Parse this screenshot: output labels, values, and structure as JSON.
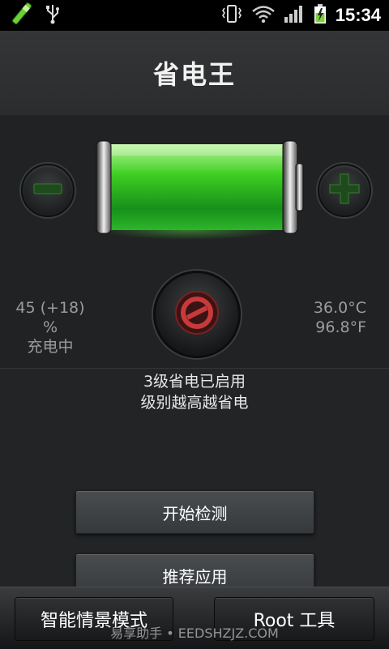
{
  "status_bar": {
    "time": "15:34",
    "icons": [
      "app-pencil-icon",
      "usb-icon",
      "vibrate-icon",
      "wifi-icon",
      "signal-icon",
      "battery-charging-icon"
    ]
  },
  "title": "省电王",
  "battery": {
    "level_fraction": 0.45,
    "color": "#37c21e"
  },
  "controls": {
    "decrease_icon": "minus-icon",
    "increase_icon": "plus-icon",
    "power_icon": "power-save-icon"
  },
  "stats": {
    "percent": "45 (+18) %",
    "state": "充电中",
    "temp_c": "36.0°C",
    "temp_f": "96.8°F"
  },
  "info": {
    "line1": "3级省电已启用",
    "line2": "级别越高越省电"
  },
  "buttons": {
    "start_check": "开始检测",
    "recommend": "推荐应用"
  },
  "bottom_bar": {
    "smart_mode": "智能情景模式",
    "root_tools": "Root 工具"
  },
  "watermark": "易享助手 • EEDSHZJZ.COM"
}
